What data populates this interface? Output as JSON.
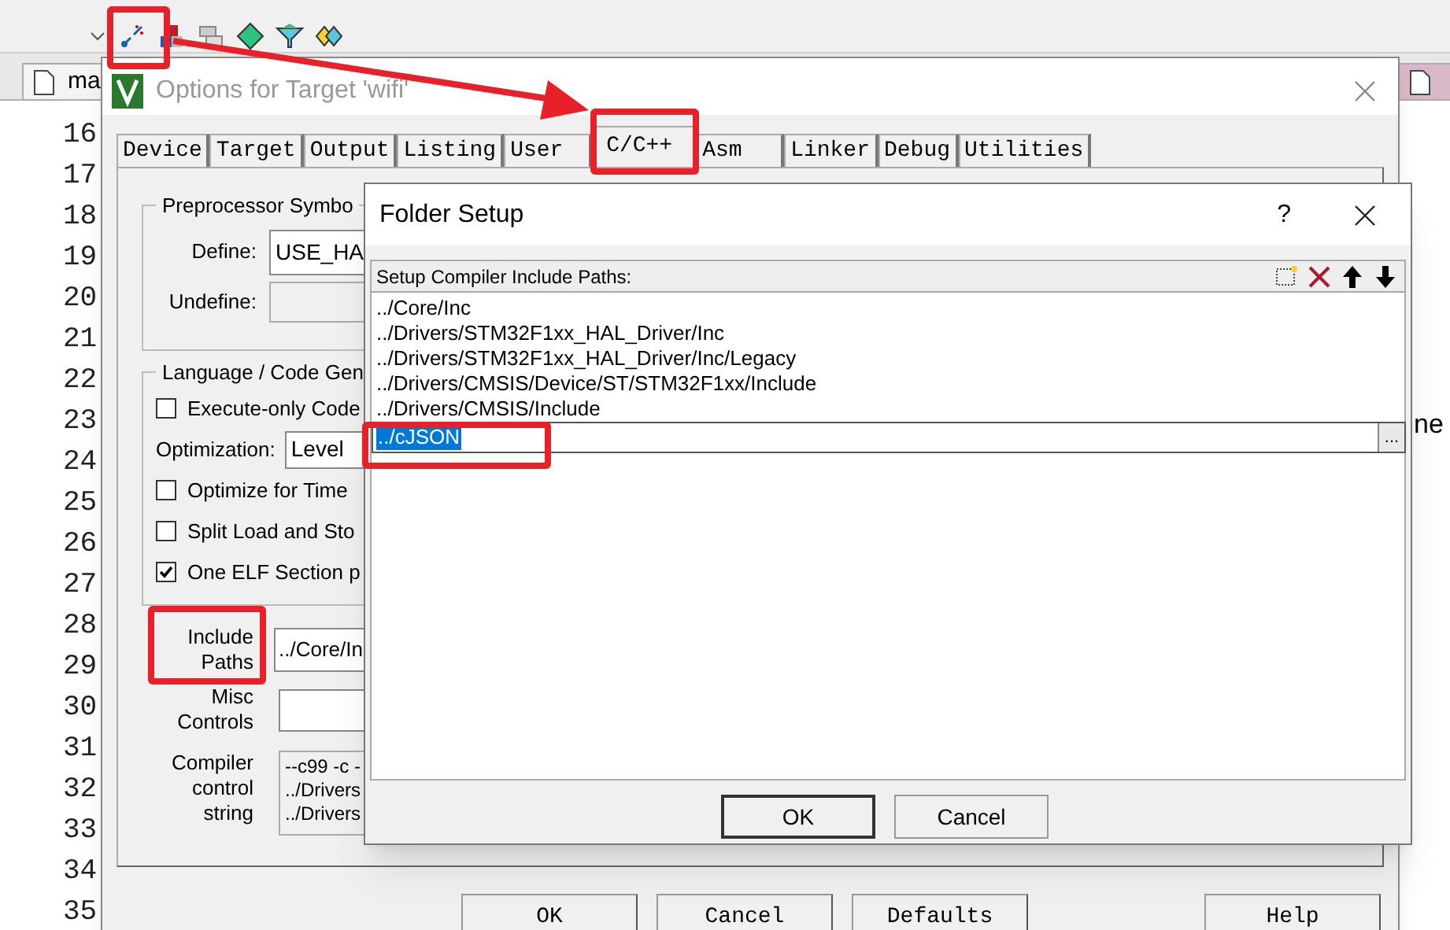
{
  "ide": {
    "editor_tab": {
      "label": "ma"
    },
    "line_numbers": [
      "16",
      "17",
      "18",
      "19",
      "20",
      "21",
      "22",
      "23",
      "24",
      "25",
      "26",
      "27",
      "28",
      "29",
      "30",
      "31",
      "32",
      "33",
      "34",
      "35"
    ],
    "code_fragment": "ne"
  },
  "options_dialog": {
    "title": "Options for Target 'wifi'",
    "tabs": [
      {
        "label": "Device",
        "selected": false
      },
      {
        "label": "Target",
        "selected": false
      },
      {
        "label": "Output",
        "selected": false
      },
      {
        "label": "Listing",
        "selected": false
      },
      {
        "label": "User",
        "selected": false
      },
      {
        "label": "C/C++",
        "selected": true
      },
      {
        "label": "Asm",
        "selected": false
      },
      {
        "label": "Linker",
        "selected": false
      },
      {
        "label": "Debug",
        "selected": false
      },
      {
        "label": "Utilities",
        "selected": false
      }
    ],
    "preprocessor": {
      "title": "Preprocessor Symbo",
      "define_label": "Define:",
      "define_value": "USE_HA",
      "undefine_label": "Undefine:"
    },
    "language": {
      "title": "Language / Code Gen",
      "options": [
        {
          "kind": "checkbox",
          "label": "Execute-only Code",
          "checked": false
        },
        {
          "kind": "select",
          "label": "Optimization:",
          "value": "Level "
        },
        {
          "kind": "checkbox",
          "label": "Optimize for Time",
          "checked": false
        },
        {
          "kind": "checkbox",
          "label": "Split Load and Sto",
          "checked": false
        },
        {
          "kind": "checkbox",
          "label": "One ELF Section p",
          "checked": true
        }
      ]
    },
    "include_paths": {
      "label": "Include Paths",
      "value": "../Core/In"
    },
    "misc_controls": {
      "label": "Misc Controls"
    },
    "compiler_control": {
      "label": "Compiler control string",
      "lines": [
        "--c99 -c -",
        "../Drivers",
        "../Drivers"
      ]
    },
    "buttons": [
      "OK",
      "Cancel",
      "Defaults",
      "Help"
    ]
  },
  "folder_setup": {
    "title": "Folder Setup",
    "help": "?",
    "header": "Setup Compiler Include Paths:",
    "paths": [
      "../Core/Inc",
      "../Drivers/STM32F1xx_HAL_Driver/Inc",
      "../Drivers/STM32F1xx_HAL_Driver/Inc/Legacy",
      "../Drivers/CMSIS/Device/ST/STM32F1xx/Include",
      "../Drivers/CMSIS/Include"
    ],
    "editing": {
      "value": "../cJSON",
      "browse": "..."
    },
    "buttons": [
      "OK",
      "Cancel"
    ]
  }
}
